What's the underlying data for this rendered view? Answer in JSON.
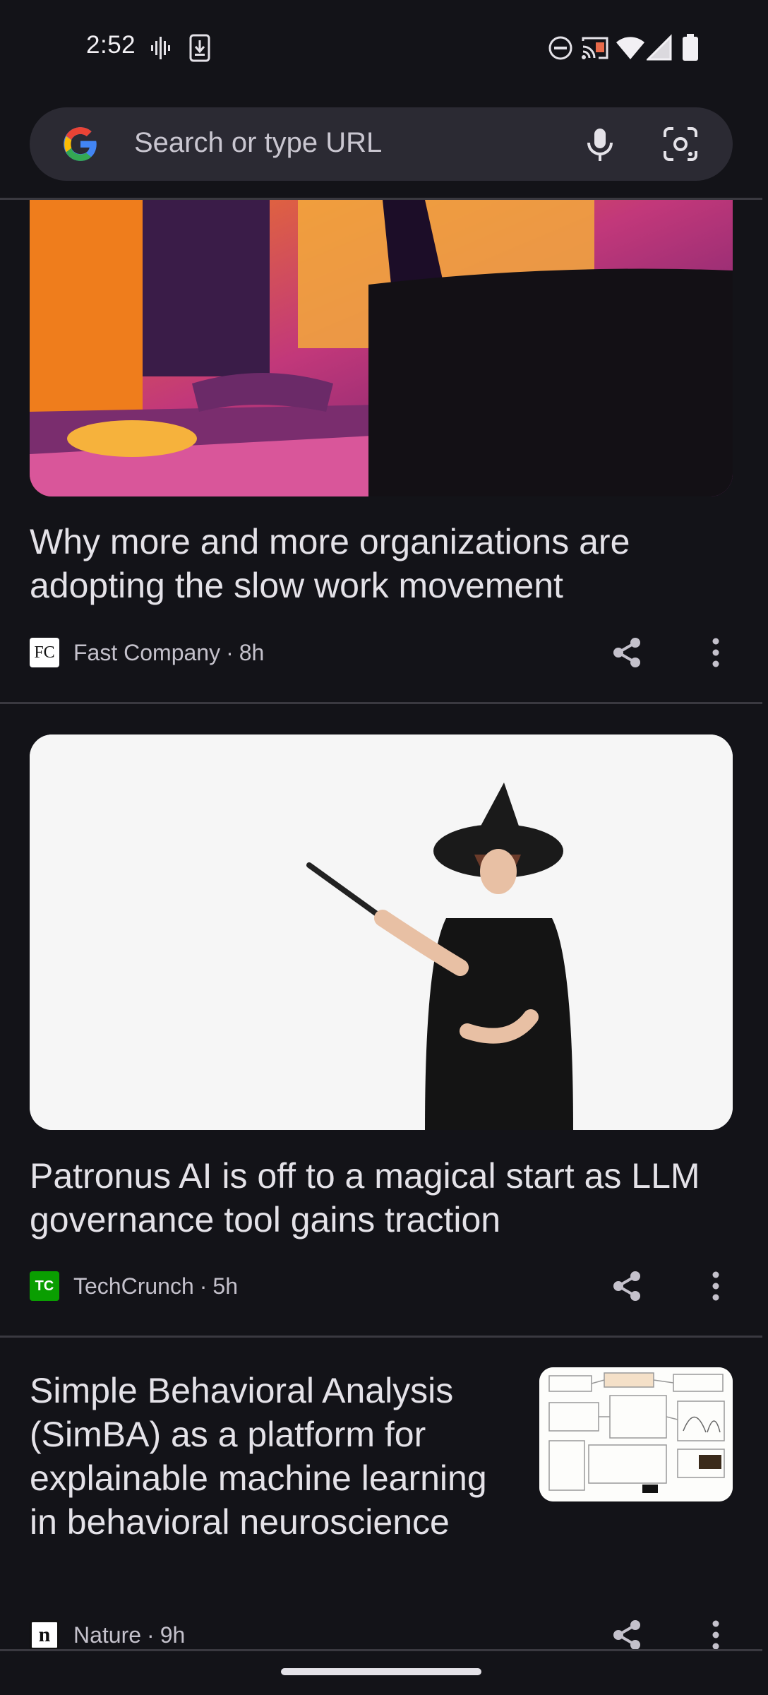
{
  "status_bar": {
    "time": "2:52",
    "left_icons": [
      "voicemail-icon",
      "download-icon"
    ],
    "right_icons": [
      "dnd-icon",
      "cast-icon",
      "wifi-icon",
      "signal-icon",
      "battery-icon"
    ]
  },
  "search": {
    "placeholder": "Search or type URL",
    "icons": [
      "google-logo-icon",
      "mic-icon",
      "lens-icon"
    ]
  },
  "feed": [
    {
      "title": "Why more and more organizations are adopting the slow work movement",
      "publisher": "Fast Company",
      "publisher_logo_text": "FC",
      "age": "8h",
      "image": "thermal-office-image"
    },
    {
      "title": "Patronus AI is off to a magical start as LLM governance tool gains traction",
      "publisher": "TechCrunch",
      "publisher_logo_text": "TC",
      "age": "5h",
      "image": "witch-wand-image"
    },
    {
      "title": "Simple Behavioral Analysis (SimBA) as a platform for explainable machine learning in behavioral neuroscience",
      "publisher": "Nature",
      "publisher_logo_text": "n",
      "age": "9h",
      "image": "flowchart-thumbnail"
    }
  ],
  "colors": {
    "background": "#131318",
    "search_bg": "#2b2a33",
    "text": "#e4e2e8",
    "meta_text": "#c4c1cb",
    "techcrunch_green": "#0a9e01"
  }
}
